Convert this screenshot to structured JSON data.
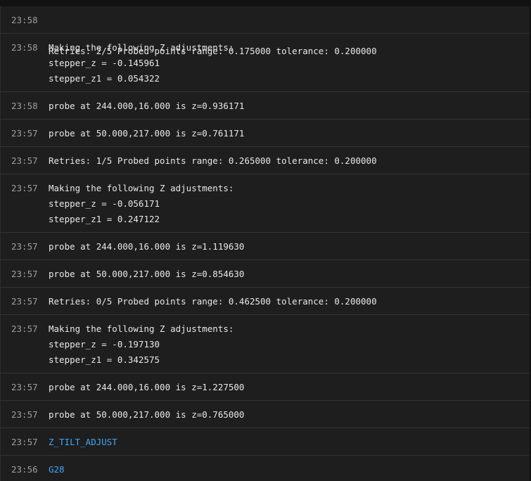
{
  "console": {
    "entries": [
      {
        "time": "23:58",
        "type": "response",
        "lines": [
          "Retries: 2/5 Probed points range: 0.175000 tolerance: 0.200000"
        ]
      },
      {
        "time": "23:58",
        "type": "response",
        "lines": [
          "Making the following Z adjustments:",
          "stepper_z = -0.145961",
          "stepper_z1 = 0.054322"
        ]
      },
      {
        "time": "23:58",
        "type": "response",
        "lines": [
          "probe at 244.000,16.000 is z=0.936171"
        ]
      },
      {
        "time": "23:57",
        "type": "response",
        "lines": [
          "probe at 50.000,217.000 is z=0.761171"
        ]
      },
      {
        "time": "23:57",
        "type": "response",
        "lines": [
          "Retries: 1/5 Probed points range: 0.265000 tolerance: 0.200000"
        ]
      },
      {
        "time": "23:57",
        "type": "response",
        "lines": [
          "Making the following Z adjustments:",
          "stepper_z = -0.056171",
          "stepper_z1 = 0.247122"
        ]
      },
      {
        "time": "23:57",
        "type": "response",
        "lines": [
          "probe at 244.000,16.000 is z=1.119630"
        ]
      },
      {
        "time": "23:57",
        "type": "response",
        "lines": [
          "probe at 50.000,217.000 is z=0.854630"
        ]
      },
      {
        "time": "23:57",
        "type": "response",
        "lines": [
          "Retries: 0/5 Probed points range: 0.462500 tolerance: 0.200000"
        ]
      },
      {
        "time": "23:57",
        "type": "response",
        "lines": [
          "Making the following Z adjustments:",
          "stepper_z = -0.197130",
          "stepper_z1 = 0.342575"
        ]
      },
      {
        "time": "23:57",
        "type": "response",
        "lines": [
          "probe at 244.000,16.000 is z=1.227500"
        ]
      },
      {
        "time": "23:57",
        "type": "response",
        "lines": [
          "probe at 50.000,217.000 is z=0.765000"
        ]
      },
      {
        "time": "23:57",
        "type": "command",
        "lines": [
          "Z_TILT_ADJUST"
        ]
      },
      {
        "time": "23:56",
        "type": "command",
        "lines": [
          "G28"
        ]
      }
    ]
  }
}
